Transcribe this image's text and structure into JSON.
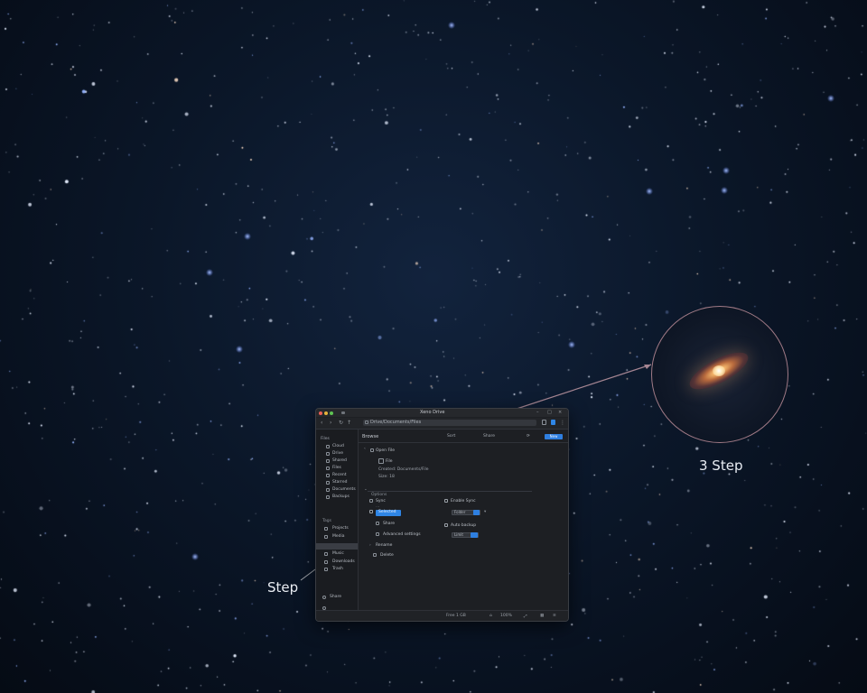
{
  "captions": {
    "inset": "3 Step",
    "window": "Step"
  },
  "window": {
    "title": "Xeno Drive",
    "toolbar": {
      "back_icon": "chevron-left-icon",
      "forward_icon": "chevron-right-icon",
      "address": "Drive/Documents/Files"
    },
    "sidebar": {
      "header": "Files",
      "items": [
        {
          "label": "Cloud",
          "icon": "cloud-icon"
        },
        {
          "label": "Drive",
          "icon": "drive-icon"
        },
        {
          "label": "Shared",
          "icon": "share-icon"
        },
        {
          "label": "Files",
          "icon": "file-icon"
        },
        {
          "label": "Recent",
          "icon": "clock-icon"
        },
        {
          "label": "Starred",
          "icon": "star-icon"
        },
        {
          "label": "Documents",
          "icon": "folder-icon"
        },
        {
          "label": "Backups",
          "icon": "archive-icon"
        }
      ],
      "section_2": "Tags",
      "items_2": [
        {
          "label": "Projects",
          "icon": "folder-icon"
        },
        {
          "label": "Media",
          "icon": "image-icon"
        },
        {
          "label": "",
          "icon": "folder-icon"
        },
        {
          "label": "Music",
          "icon": "music-icon"
        },
        {
          "label": "Downloads",
          "icon": "download-icon"
        },
        {
          "label": "Trash",
          "icon": "trash-icon"
        }
      ],
      "footer_item": "Share",
      "settings_icon": "gear-icon"
    },
    "main": {
      "header_title": "Browse",
      "tabs": [
        "Sort",
        "Share"
      ],
      "action_label": "New",
      "section_title": "Open File",
      "file_name": "File",
      "file_meta": "Created: Documents/File",
      "file_sub": "Size: 18",
      "options_title": "Options",
      "option_rows": [
        "Sync",
        "Selected",
        "Share",
        "Advanced settings",
        "Rename",
        "Delete"
      ],
      "right_options": [
        "Enable Sync",
        "Auto backup"
      ],
      "input_1": "Folder",
      "input_2": "Limit"
    },
    "status": {
      "center": "Free 1 GB",
      "right": "100%"
    }
  }
}
